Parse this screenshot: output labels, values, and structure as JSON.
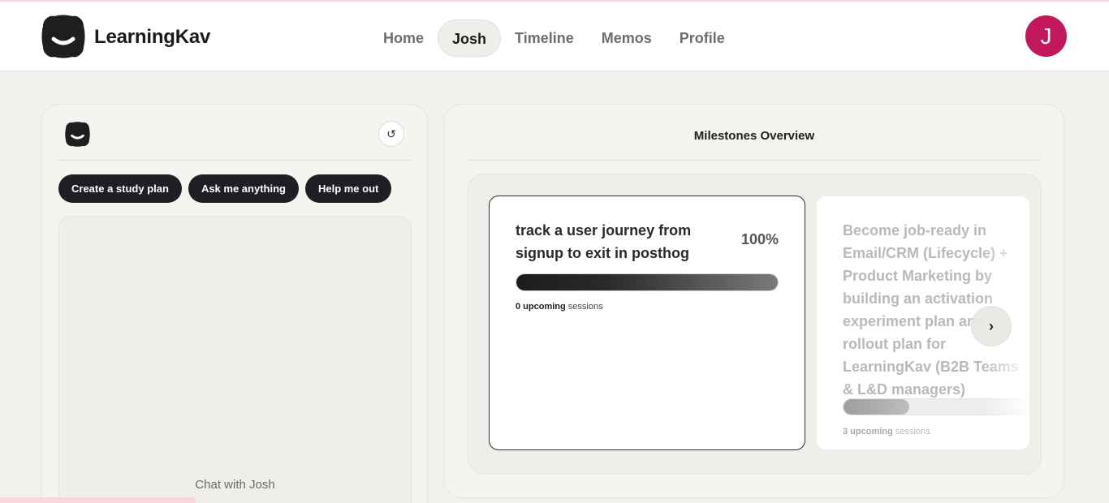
{
  "header": {
    "brand": "LearningKav",
    "nav": [
      {
        "label": "Home",
        "active": false
      },
      {
        "label": "Josh",
        "active": true
      },
      {
        "label": "Timeline",
        "active": false
      },
      {
        "label": "Memos",
        "active": false
      },
      {
        "label": "Profile",
        "active": false
      }
    ],
    "avatar_initial": "J",
    "avatar_color": "#c2185b"
  },
  "chat": {
    "refresh_icon": "↺",
    "chips": [
      "Create a study plan",
      "Ask me anything",
      "Help me out"
    ],
    "empty_label": "Chat with Josh"
  },
  "milestones": {
    "title": "Milestones Overview",
    "cards": [
      {
        "title": "track a user journey from signup to exit in posthog",
        "percent_label": "100%",
        "progress": 1.0,
        "upcoming_count": "0 upcoming",
        "sessions_label": "sessions"
      },
      {
        "title": "Become job-ready in Email/CRM (Lifecycle) + Product Marketing by building an activation experiment plan and rollout plan for LearningKav (B2B Teams & L&D managers)",
        "progress": 0.35,
        "upcoming_count": "3 upcoming",
        "sessions_label": "sessions"
      }
    ],
    "next_arrow": "›"
  }
}
